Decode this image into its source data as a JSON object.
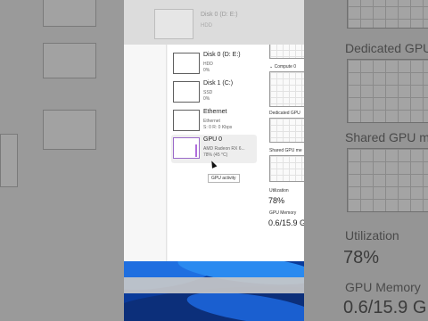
{
  "background_zoom": {
    "dedicated_label": "Dedicated GPU m",
    "shared_label": "Shared GPU mem",
    "utilization_label": "Utilization",
    "utilization_value": "78%",
    "gpu_memory_label": "GPU Memory",
    "gpu_memory_value": "0.6/15.9 G"
  },
  "top_strip": {
    "title": "Disk 0 (D: E:)",
    "sub": "HDD"
  },
  "devices": [
    {
      "name": "Disk 0 (D: E:)",
      "line1": "HDD",
      "line2": "0%"
    },
    {
      "name": "Disk 1 (C:)",
      "line1": "SSD",
      "line2": "0%"
    },
    {
      "name": "Ethernet",
      "line1": "Ethernet",
      "line2": "S: 0 R: 0 Kbps"
    },
    {
      "name": "GPU 0",
      "line1": "AMD Radeon RX 6...",
      "line2": "78% (45 °C)"
    }
  ],
  "tooltip": "GPU activity",
  "detail": {
    "compute_label": "⌄ Compute 0",
    "dedicated_label": "Dedicated GPU",
    "shared_label": "Shared GPU me",
    "utilization_label": "Utilization",
    "utilization_value": "78%",
    "gpu_memory_label": "GPU Memory",
    "gpu_memory_value": "0.6/15.9 G"
  },
  "colors": {
    "gpu_accent": "#b06ddd",
    "wallpaper": "#0a3a9a"
  }
}
